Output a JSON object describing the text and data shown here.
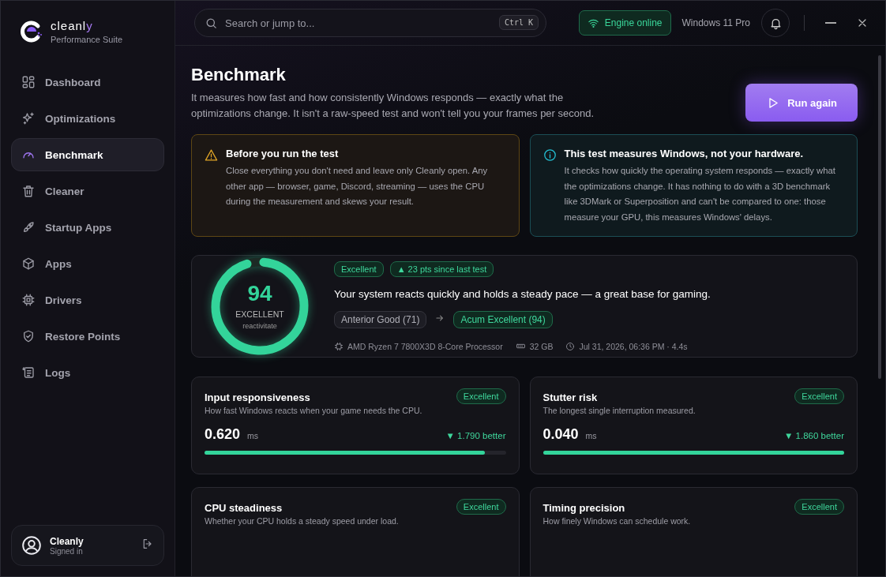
{
  "brand": {
    "name": "cleanl",
    "accent": "y",
    "subtitle": "Performance Suite"
  },
  "sidebar": {
    "items": [
      {
        "label": "Dashboard",
        "selected": false
      },
      {
        "label": "Optimizations",
        "selected": false
      },
      {
        "label": "Benchmark",
        "selected": true
      },
      {
        "label": "Cleaner",
        "selected": false
      },
      {
        "label": "Startup Apps",
        "selected": false
      },
      {
        "label": "Apps",
        "selected": false
      },
      {
        "label": "Drivers",
        "selected": false
      },
      {
        "label": "Restore Points",
        "selected": false
      },
      {
        "label": "Logs",
        "selected": false
      }
    ],
    "user": {
      "name": "Cleanly",
      "status": "Signed in"
    }
  },
  "topbar": {
    "search": {
      "placeholder": "Search or jump to...",
      "shortcut": "Ctrl K"
    },
    "engine_status": "Engine online",
    "os": "Windows 11 Pro"
  },
  "page": {
    "title": "Benchmark",
    "description": "It measures how fast and how consistently Windows responds — exactly what the optimizations change. It isn't a raw-speed test and won't tell you your frames per second.",
    "run_button": "Run again"
  },
  "notices": [
    {
      "kind": "warning",
      "title": "Before you run the test",
      "text": "Close everything you don't need and leave only Cleanly open. Any other app — browser, game, Discord, streaming — uses the CPU during the measurement and skews your result."
    },
    {
      "kind": "info",
      "title": "This test measures Windows, not your hardware.",
      "text": "It checks how quickly the operating system responds — exactly what the optimizations change. It has nothing to do with a 3D benchmark like 3DMark or Superposition and can't be compared to one: those measure your GPU, this measures Windows' delays."
    }
  ],
  "score": {
    "value": "94",
    "level": 0.94,
    "rating": "EXCELLENT",
    "caption": "reactivitate",
    "badge": "Excellent",
    "change": "▲ 23 pts since last test",
    "summary": "Your system reacts quickly and holds a steady pace — a great base for gaming.",
    "previous": "Anterior Good (71)",
    "current": "Acum Excellent (94)",
    "cpu": "AMD Ryzen 7 7800X3D 8-Core Processor",
    "ram": "32 GB",
    "time": "Jul 31, 2026, 06:36 PM · 4.4s"
  },
  "metrics": [
    {
      "title": "Input responsiveness",
      "badge": "Excellent",
      "description": "How fast Windows reacts when your game needs the CPU.",
      "value": "0.620",
      "unit": "ms",
      "delta": "▼ 1.790 better",
      "level": 0.93
    },
    {
      "title": "Stutter risk",
      "badge": "Excellent",
      "description": "The longest single interruption measured.",
      "value": "0.040",
      "unit": "ms",
      "delta": "▼ 1.860 better",
      "level": 1.0
    },
    {
      "title": "CPU steadiness",
      "badge": "Excellent",
      "description": "Whether your CPU holds a steady speed under load."
    },
    {
      "title": "Timing precision",
      "badge": "Excellent",
      "description": "How finely Windows can schedule work."
    }
  ]
}
